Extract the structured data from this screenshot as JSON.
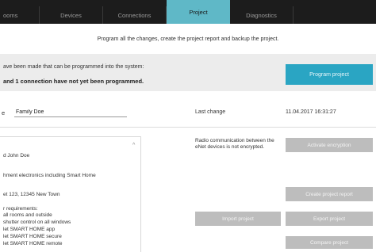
{
  "tabs": [
    {
      "label": "Rooms",
      "visible_label": "ooms"
    },
    {
      "label": "Devices"
    },
    {
      "label": "Connections"
    },
    {
      "label": "Project"
    },
    {
      "label": "Diagnostics"
    }
  ],
  "header": {
    "instruction": "Program all the changes, create the project report and backup the project."
  },
  "status": {
    "line1": "ave been made that can be programmed into the system:",
    "line2": "and 1 connection have not yet been programmed.",
    "program_button": "Program project"
  },
  "project": {
    "name_label": "e",
    "name_value": "Family Doe",
    "last_change_label": "Last change",
    "last_change_value": "11.04.2017 16:31:27"
  },
  "description": {
    "lines": [
      "d John Doe",
      "hment electronics including Smart Home",
      "et 123, 12345 New Town",
      "r requirements:",
      " all rooms and outside",
      "shutter control on all windows",
      "let SMART HOME app",
      "let SMART HOME secure",
      "let SMART HOME remote"
    ]
  },
  "encryption": {
    "text": "Radio communication between the eNet devices is not encrypted.",
    "activate_button": "Activate encryption"
  },
  "actions": {
    "create_report": "Create project report",
    "import": "Import project",
    "export": "Export project",
    "compare": "Compare project"
  },
  "colors": {
    "tabbar_bg": "#1c1c1c",
    "active_tab": "#5fb8c7",
    "primary_button": "#2aa5c3",
    "secondary_button": "#bdbdbd",
    "band_bg": "#ececec"
  }
}
